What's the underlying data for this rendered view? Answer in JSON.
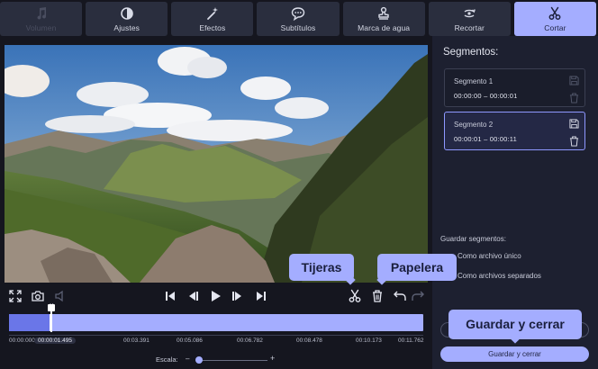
{
  "toolbar": [
    {
      "label": "Volumen",
      "icon": "music-note-icon",
      "disabled": true
    },
    {
      "label": "Ajustes",
      "icon": "contrast-icon"
    },
    {
      "label": "Efectos",
      "icon": "magic-wand-icon"
    },
    {
      "label": "Subtítulos",
      "icon": "speech-bubble-icon"
    },
    {
      "label": "Marca de agua",
      "icon": "stamp-icon"
    },
    {
      "label": "Recortar",
      "icon": "crop-rotate-icon"
    },
    {
      "label": "Cortar",
      "icon": "scissors-icon",
      "active": true
    }
  ],
  "side": {
    "title": "Segmentos:",
    "segments": [
      {
        "name": "Segmento 1",
        "range": "00:00:00 – 00:00:01"
      },
      {
        "name": "Segmento 2",
        "range": "00:00:01 – 00:00:11"
      }
    ],
    "save_label": "Guardar segmentos:",
    "options": [
      "Como archivo único",
      "Como archivos separados"
    ],
    "save_button": "Guardar y cerrar"
  },
  "timeline": {
    "ticks": [
      "00:00:000",
      "00:00:01.495",
      "00:03.391",
      "00:05.086",
      "00:06.782",
      "00:08.478",
      "00:10.173",
      "00:11.762"
    ],
    "current": "00:00:01.495",
    "x_marker": "X",
    "scale_label": "Escala:",
    "zoom_minus": "–",
    "zoom_plus": "+",
    "zoom_level": 0.05
  },
  "callouts": {
    "tijeras": "Tijeras",
    "papelera": "Papelera",
    "guardar": "Guardar y cerrar"
  },
  "colors": {
    "accent": "#a4adff",
    "background": "#15161f",
    "panel": "#1d2030"
  }
}
